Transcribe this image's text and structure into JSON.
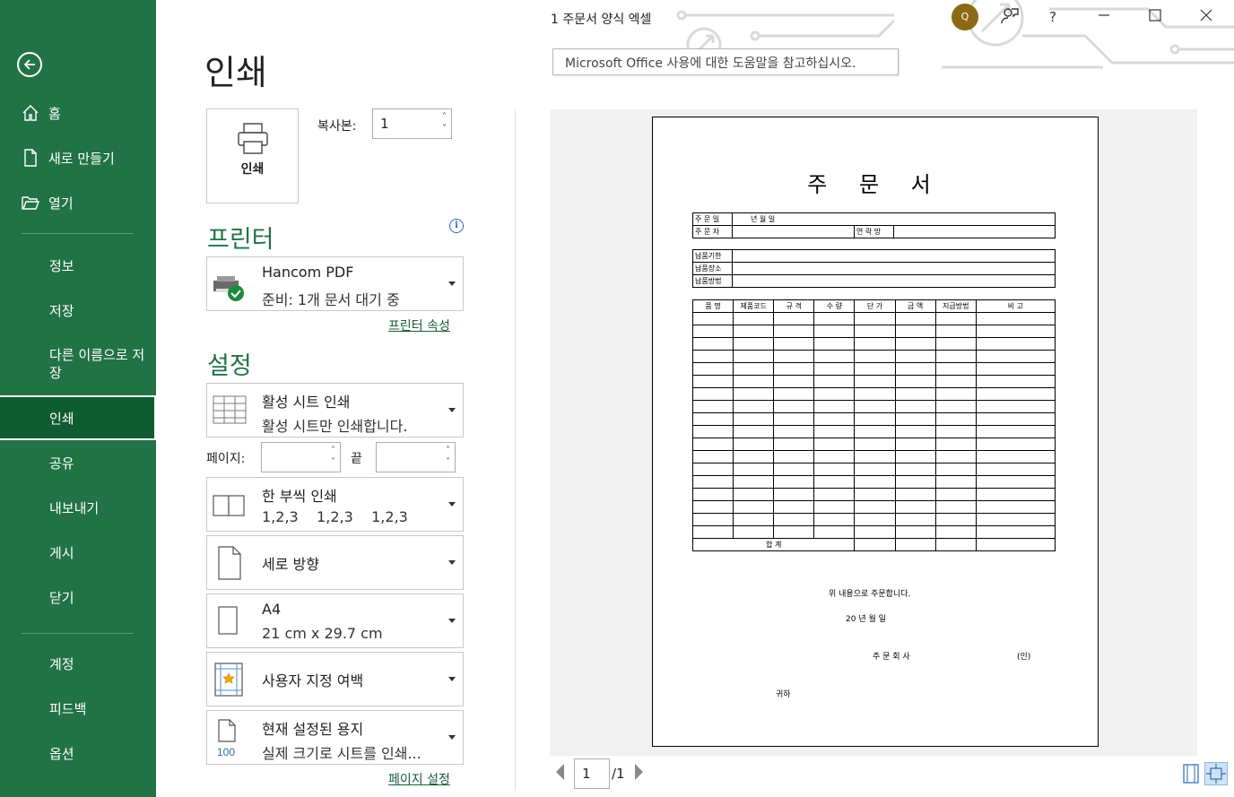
{
  "window": {
    "title": "1 주문서 양식 엑셀",
    "help_tooltip": "Microsoft Office 사용에 대한 도움말을 참고하십시오.",
    "help_button": "?"
  },
  "sidebar": {
    "items": [
      {
        "label": "홈",
        "icon": "home-icon"
      },
      {
        "label": "새로 만들기",
        "icon": "new-file-icon"
      },
      {
        "label": "열기",
        "icon": "folder-open-icon"
      },
      {
        "label": "정보"
      },
      {
        "label": "저장"
      },
      {
        "label": "다른 이름으로 저장"
      },
      {
        "label": "인쇄",
        "active": true
      },
      {
        "label": "공유"
      },
      {
        "label": "내보내기"
      },
      {
        "label": "게시"
      },
      {
        "label": "닫기"
      },
      {
        "label": "계정"
      },
      {
        "label": "피드백"
      },
      {
        "label": "옵션"
      }
    ]
  },
  "print": {
    "page_title": "인쇄",
    "print_button": "인쇄",
    "copies_label": "복사본:",
    "copies_value": "1",
    "printer_heading": "프린터",
    "printer_name": "Hancom PDF",
    "printer_status": "준비: 1개 문서 대기 중",
    "printer_properties": "프린터 속성",
    "settings_heading": "설정",
    "scope_title": "활성 시트 인쇄",
    "scope_sub": "활성 시트만 인쇄합니다.",
    "pages_label": "페이지:",
    "end_label": "끝",
    "collate_title": "한 부씩 인쇄",
    "collate_sub": "1,2,3    1,2,3    1,2,3",
    "orientation": "세로 방향",
    "paper_title": "A4",
    "paper_sub": "21 cm x 29.7 cm",
    "margins": "사용자 지정 여백",
    "scaling_title": "현재 설정된 용지",
    "scaling_sub": "실제 크기로 시트를 인쇄...",
    "scaling_icon_text": "100",
    "page_setup": "페이지 설정"
  },
  "preview": {
    "current_page": "1",
    "total_pages": "/1",
    "form": {
      "title": "주 문 서",
      "order_date_label": "주 문 일",
      "order_date_value": "년    월    일",
      "orderer_label": "주 문 자",
      "contact_label": "연 락 망",
      "delivery_rows": [
        "납품기한",
        "납품장소",
        "납품방법"
      ],
      "columns": [
        "품    명",
        "제품코드",
        "규    격",
        "수    량",
        "단    가",
        "금    액",
        "지급방법",
        "비    고"
      ],
      "total_label": "합    계",
      "closing": "위 내용으로 주문합니다.",
      "date_line": "20   년    월    일",
      "company": "주 문 회 사",
      "seal": "(인)",
      "recipient": "귀하"
    }
  }
}
